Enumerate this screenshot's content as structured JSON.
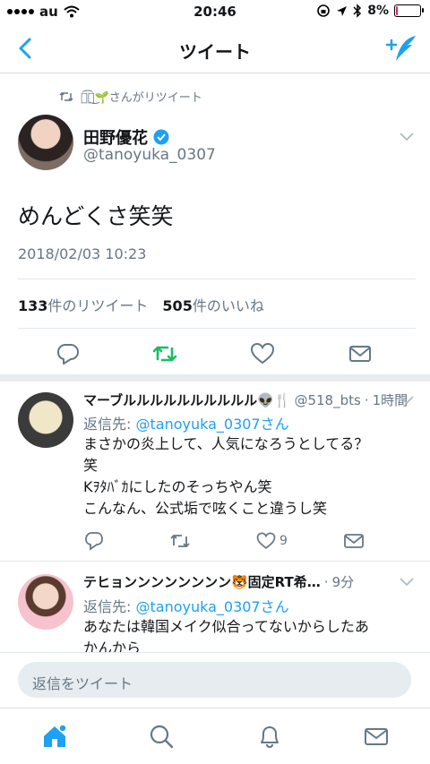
{
  "status": {
    "carrier": "au",
    "time": "20:46",
    "battery": "8%",
    "battery_level": 0.08
  },
  "nav": {
    "title": "ツイート",
    "back_icon": "chevron-left-icon",
    "compose_icon": "compose-tweet-icon"
  },
  "tweet": {
    "retweeted_by": "ス͡ズ͜🌱さんがリツイート",
    "author_name": "田野優花",
    "author_handle": "@tanoyuka_0307",
    "text": "めんどくさ笑笑",
    "date": "2018/02/03 10:23",
    "retweet_count": "133",
    "retweet_label": "件のリツイート",
    "like_count": "505",
    "like_label": "件のいいね",
    "accent_color": "#1da1f2",
    "retweet_color": "#17bf63"
  },
  "replies": [
    {
      "name": "マーブルルルルルルルルルル👽🍴",
      "handle": "@518_bts",
      "time": "1時間",
      "reply_to_label": "返信先: ",
      "reply_to": "@tanoyuka_0307さん",
      "body": [
        "まさかの炎上して、人気になろうとしてる？",
        "笑",
        "Kｦﾀﾊﾞｶにしたのそっちやん笑",
        "こんなん、公式垢で呟くこと違うし笑"
      ],
      "like_count": "9"
    },
    {
      "name": "テヒョンンンンンンンン🐯固定RT希…",
      "time": "9分",
      "reply_to_label": "返信先: ",
      "reply_to": "@tanoyuka_0307さん",
      "body": [
        "あなたは韓国メイク似合ってないからしたあ",
        "かんから"
      ]
    }
  ],
  "reply_bar": {
    "placeholder": "返信をツイート"
  },
  "tabs": [
    {
      "name": "home",
      "icon": "home-icon"
    },
    {
      "name": "search",
      "icon": "search-icon"
    },
    {
      "name": "notifications",
      "icon": "bell-icon"
    },
    {
      "name": "messages",
      "icon": "mail-icon"
    }
  ]
}
